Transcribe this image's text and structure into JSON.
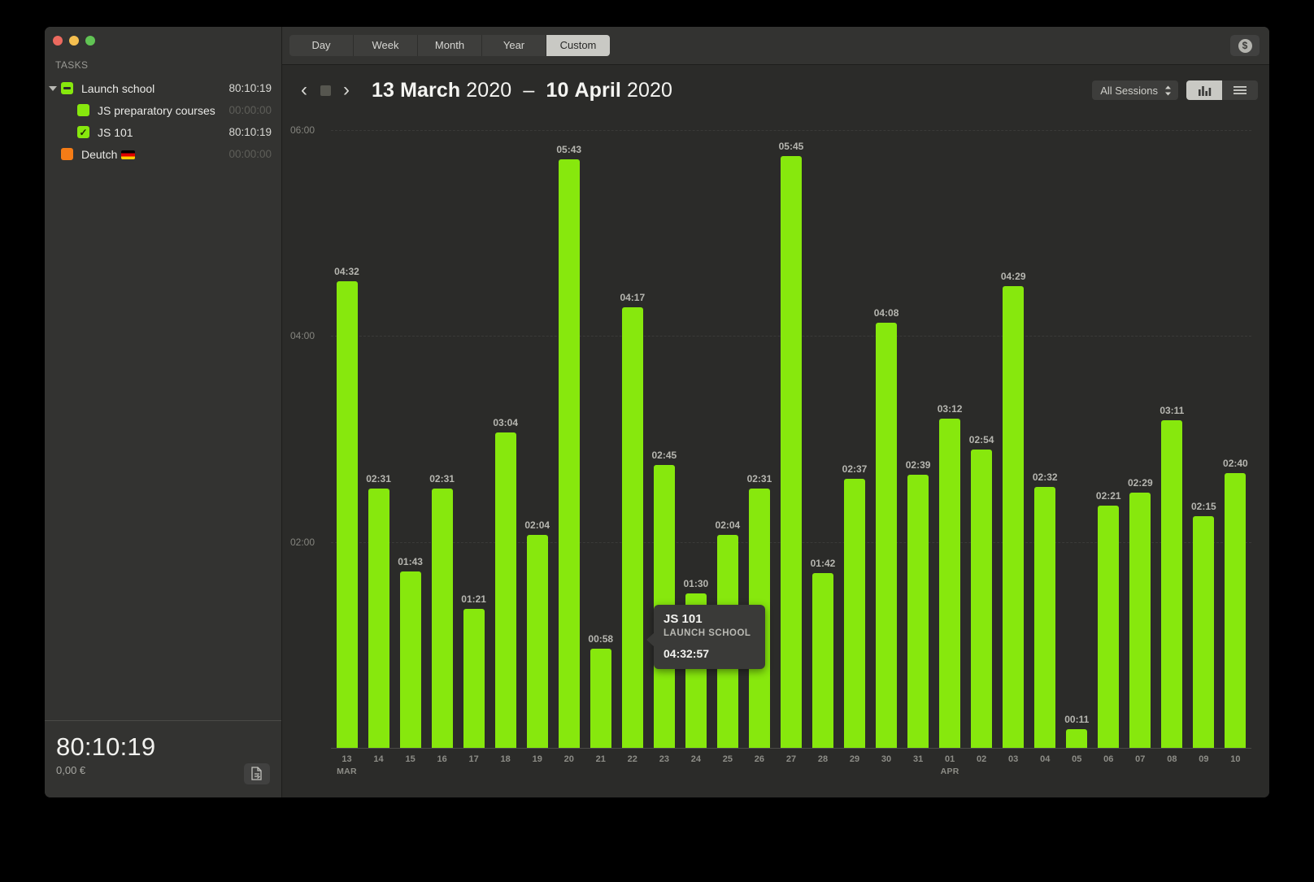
{
  "window": {
    "traffic_lights": [
      "close",
      "minimize",
      "zoom"
    ]
  },
  "sidebar": {
    "header": "TASKS",
    "items": [
      {
        "label": "Launch school",
        "time": "80:10:19",
        "chip": "green-minus",
        "level": 0,
        "expanded": true
      },
      {
        "label": "JS preparatory courses",
        "time": "00:00:00",
        "chip": "green",
        "level": 1,
        "zero": true
      },
      {
        "label": "JS 101",
        "time": "80:10:19",
        "chip": "green-check",
        "level": 1
      },
      {
        "label": "Deutch",
        "time": "00:00:00",
        "chip": "orange",
        "level": 0,
        "zero": true,
        "flag": "de"
      }
    ],
    "footer": {
      "total_time": "80:10:19",
      "amount": "0,00 €",
      "export_icon": "document-export-icon"
    }
  },
  "toolbar": {
    "segments": [
      {
        "label": "Day",
        "active": false
      },
      {
        "label": "Week",
        "active": false
      },
      {
        "label": "Month",
        "active": false
      },
      {
        "label": "Year",
        "active": false
      },
      {
        "label": "Custom",
        "active": true
      }
    ],
    "money_button_icon": "dollar-coin-icon"
  },
  "datebar": {
    "prev_icon": "chevron-left-icon",
    "stop_icon": "stop-square-icon",
    "next_icon": "chevron-right-icon",
    "range": {
      "start_day": "13",
      "start_month": "March",
      "start_year": "2020",
      "dash": "–",
      "end_day": "10",
      "end_month": "April",
      "end_year": "2020"
    },
    "sessions_filter": "All Sessions",
    "view_chart_icon": "bar-chart-icon",
    "view_list_icon": "list-icon"
  },
  "tooltip": {
    "title": "JS 101",
    "project": "LAUNCH SCHOOL",
    "duration": "04:32:57"
  },
  "chart_data": {
    "type": "bar",
    "title": "",
    "xlabel": "",
    "ylabel": "",
    "ylim": [
      0,
      6.333
    ],
    "grid": true,
    "yticks": [
      "02:00",
      "04:00",
      "06:00"
    ],
    "ytick_values": [
      2.0,
      4.0,
      6.0
    ],
    "bar_color": "#87e80d",
    "month_markers": [
      {
        "index": 0,
        "label": "MAR"
      },
      {
        "index": 19,
        "label": "APR"
      }
    ],
    "categories": [
      "13",
      "14",
      "15",
      "16",
      "17",
      "18",
      "19",
      "20",
      "21",
      "22",
      "23",
      "24",
      "25",
      "26",
      "27",
      "28",
      "29",
      "30",
      "31",
      "01",
      "02",
      "03",
      "04",
      "05",
      "06",
      "07",
      "08",
      "09",
      "10"
    ],
    "labels": [
      "04:32",
      "02:31",
      "01:43",
      "02:31",
      "01:21",
      "03:04",
      "02:04",
      "05:43",
      "00:58",
      "04:17",
      "02:45",
      "01:30",
      "02:04",
      "02:31",
      "05:45",
      "01:42",
      "02:37",
      "04:08",
      "02:39",
      "03:12",
      "02:54",
      "04:29",
      "02:32",
      "00:11",
      "02:21",
      "02:29",
      "03:11",
      "02:15",
      "02:40"
    ],
    "values": [
      4.533,
      2.517,
      1.717,
      2.517,
      1.35,
      3.067,
      2.067,
      5.717,
      0.967,
      4.283,
      2.75,
      1.5,
      2.067,
      2.517,
      5.75,
      1.7,
      2.617,
      4.133,
      2.65,
      3.2,
      2.9,
      4.483,
      2.533,
      0.183,
      2.35,
      2.483,
      3.183,
      2.25,
      2.667
    ]
  }
}
